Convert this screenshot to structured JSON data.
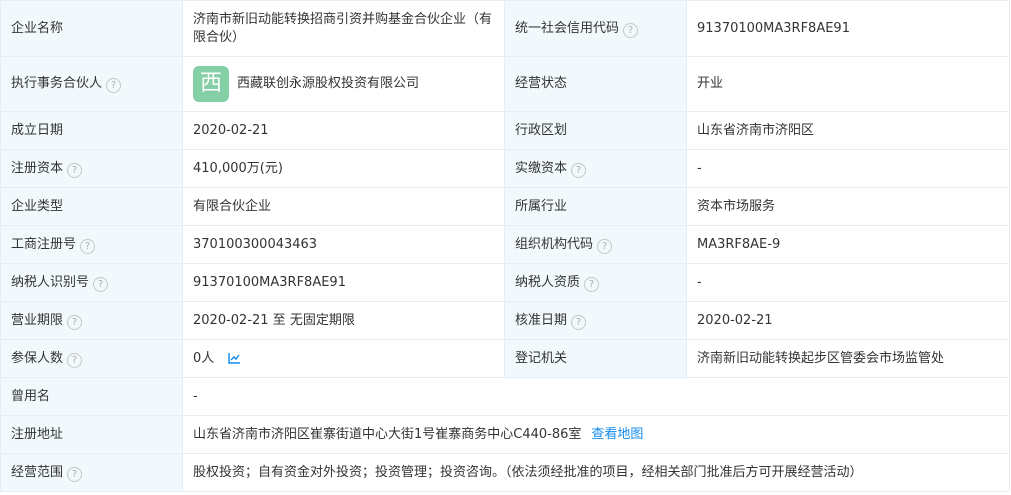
{
  "rows": {
    "r1": {
      "l1": "企业名称",
      "v1": "济南市新旧动能转换招商引资并购基金合伙企业（有限合伙）",
      "l2": "统一社会信用代码",
      "v2": "91370100MA3RF8AE91"
    },
    "r2": {
      "l1": "执行事务合伙人",
      "logo_char": "西",
      "v1": "西藏联创永源股权投资有限公司",
      "l2": "经营状态",
      "v2": "开业"
    },
    "r3": {
      "l1": "成立日期",
      "v1": "2020-02-21",
      "l2": "行政区划",
      "v2": "山东省济南市济阳区"
    },
    "r4": {
      "l1": "注册资本",
      "v1": "410,000万(元)",
      "l2": "实缴资本",
      "v2": "-"
    },
    "r5": {
      "l1": "企业类型",
      "v1": "有限合伙企业",
      "l2": "所属行业",
      "v2": "资本市场服务"
    },
    "r6": {
      "l1": "工商注册号",
      "v1": "370100300043463",
      "l2": "组织机构代码",
      "v2": "MA3RF8AE-9"
    },
    "r7": {
      "l1": "纳税人识别号",
      "v1": "91370100MA3RF8AE91",
      "l2": "纳税人资质",
      "v2": "-"
    },
    "r8": {
      "l1": "营业期限",
      "v1": "2020-02-21 至 无固定期限",
      "l2": "核准日期",
      "v2": "2020-02-21"
    },
    "r9": {
      "l1": "参保人数",
      "v1": "0人",
      "l2": "登记机关",
      "v2": "济南新旧动能转换起步区管委会市场监管处"
    },
    "r10": {
      "l1": "曾用名",
      "v1": "-"
    },
    "r11": {
      "l1": "注册地址",
      "v1": "山东省济南市济阳区崔寨街道中心大街1号崔寨商务中心C440-86室",
      "link": "查看地图"
    },
    "r12": {
      "l1": "经营范围",
      "v1": "股权投资；自有资金对外投资；投资管理；投资咨询。（依法须经批准的项目，经相关部门批准后方可开展经营活动）"
    }
  },
  "icons": {
    "help": "question-circle-icon",
    "trend": "line-chart-icon"
  },
  "colors": {
    "label_bg": "#f2f9fc",
    "border": "#e4eef6",
    "link": "#128bed",
    "logo_bg": "#85cfa6",
    "help_icon": "#c6c6c6"
  }
}
